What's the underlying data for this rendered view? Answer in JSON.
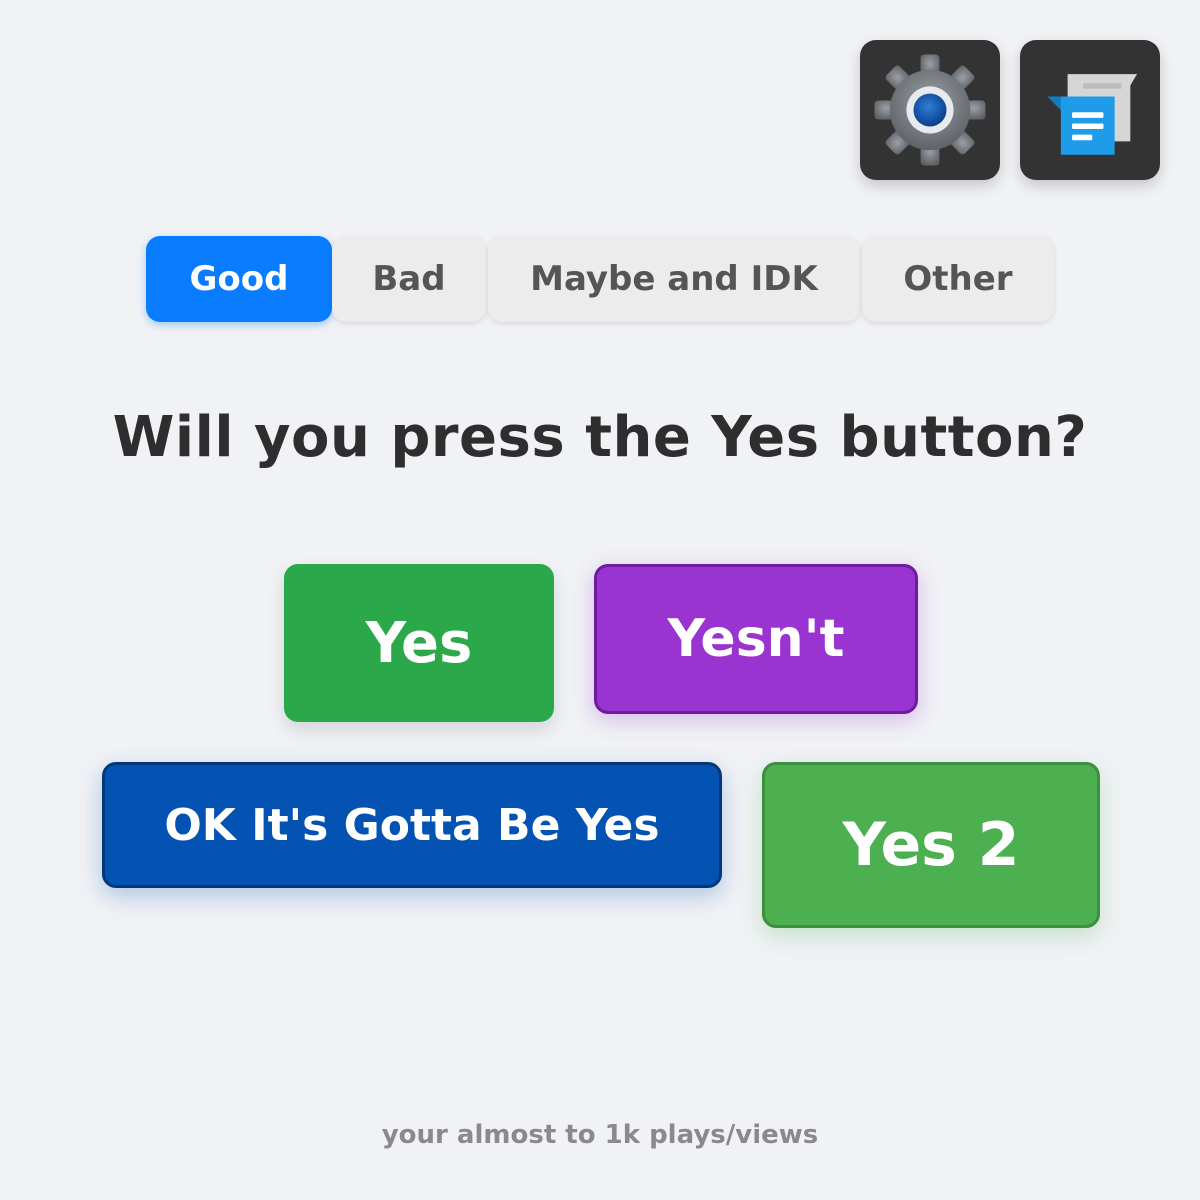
{
  "apps": {
    "settings_icon": "gear-icon",
    "messages_icon": "chat-icon"
  },
  "tabs": [
    {
      "label": "Good",
      "active": true
    },
    {
      "label": "Bad",
      "active": false
    },
    {
      "label": "Maybe and IDK",
      "active": false
    },
    {
      "label": "Other",
      "active": false
    }
  ],
  "question": "Will you press the Yes button?",
  "buttons": {
    "yes": "Yes",
    "yesnt": "Yesn't",
    "ok": "OK It's Gotta Be Yes",
    "yes2": "Yes 2"
  },
  "footer": "your almost to 1k plays/views",
  "colors": {
    "background": "#f0f2f5",
    "tab_active": "#0a7cff",
    "yes": "#2aa84a",
    "yesnt": "#9a34d0",
    "ok": "#0453b3",
    "yes2": "#4caf50"
  }
}
